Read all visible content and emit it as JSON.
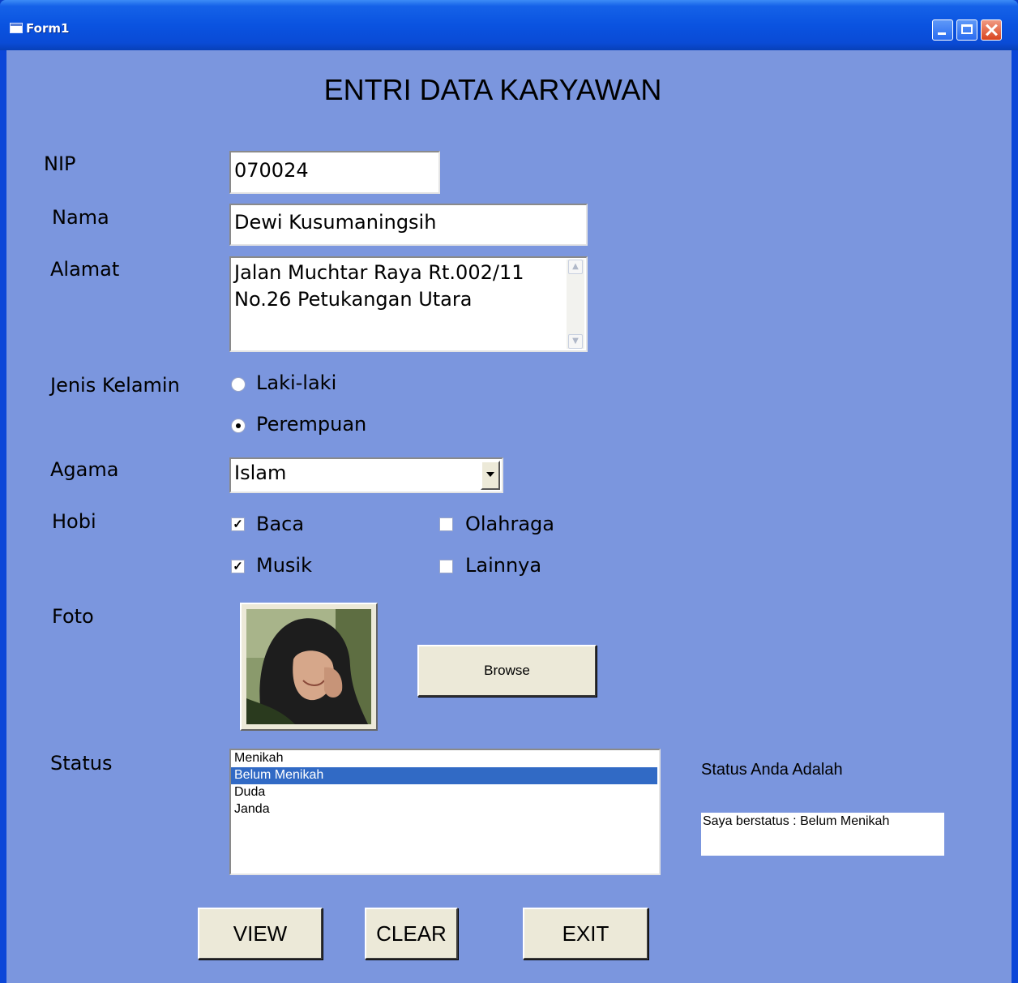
{
  "window": {
    "title": "Form1"
  },
  "heading": "ENTRI DATA KARYAWAN",
  "fields": {
    "nip": {
      "label": "NIP",
      "value": "070024"
    },
    "nama": {
      "label": "Nama",
      "value": "Dewi Kusumaningsih"
    },
    "alamat": {
      "label": "Alamat",
      "line1": "Jalan Muchtar Raya Rt.002/11",
      "line2": "No.26 Petukangan Utara"
    },
    "jenis_kelamin": {
      "label": "Jenis Kelamin",
      "options": [
        "Laki-laki",
        "Perempuan"
      ],
      "selected": "Perempuan"
    },
    "agama": {
      "label": "Agama",
      "value": "Islam"
    },
    "hobi": {
      "label": "Hobi",
      "options": [
        {
          "label": "Baca",
          "checked": true
        },
        {
          "label": "Olahraga",
          "checked": false
        },
        {
          "label": "Musik",
          "checked": true
        },
        {
          "label": "Lainnya",
          "checked": false
        }
      ]
    },
    "foto": {
      "label": "Foto",
      "browse_label": "Browse"
    },
    "status": {
      "label": "Status",
      "items": [
        "Menikah",
        "Belum Menikah",
        "Duda",
        "Janda"
      ],
      "selected": "Belum Menikah"
    }
  },
  "status_result": {
    "caption": "Status Anda Adalah",
    "text": "Saya berstatus : Belum Menikah"
  },
  "buttons": {
    "view": "VIEW",
    "clear": "CLEAR",
    "exit": "EXIT"
  },
  "colors": {
    "form_background": "#7b96de",
    "titlebar": "#0a53e0",
    "selection": "#316ac5"
  }
}
